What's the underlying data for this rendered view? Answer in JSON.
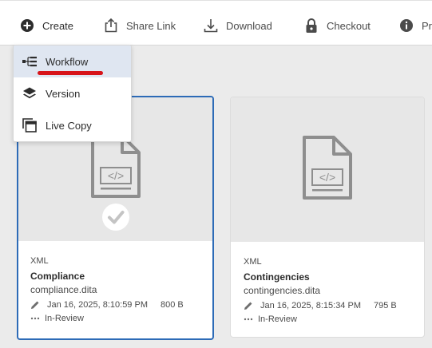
{
  "toolbar": {
    "create_label": "Create",
    "share_label": "Share Link",
    "download_label": "Download",
    "checkout_label": "Checkout",
    "properties_label": "Pro"
  },
  "create_menu": {
    "items": [
      {
        "label": "Workflow",
        "icon": "workflow-icon"
      },
      {
        "label": "Version",
        "icon": "layers-icon"
      },
      {
        "label": "Live Copy",
        "icon": "live-copy-icon"
      }
    ],
    "highlighted": "Workflow"
  },
  "cards": [
    {
      "type": "XML",
      "title": "Compliance",
      "filename": "compliance.dita",
      "modified": "Jan 16, 2025, 8:10:59 PM",
      "size": "800 B",
      "status": "In-Review",
      "selected": true
    },
    {
      "type": "XML",
      "title": "Contingencies",
      "filename": "contingencies.dita",
      "modified": "Jan 16, 2025, 8:15:34 PM",
      "size": "795 B",
      "status": "In-Review",
      "selected": false
    }
  ],
  "colors": {
    "selection_border": "#2d6bb7",
    "annotation_underline": "#d7141a",
    "menu_highlight": "#dfe6f1"
  }
}
